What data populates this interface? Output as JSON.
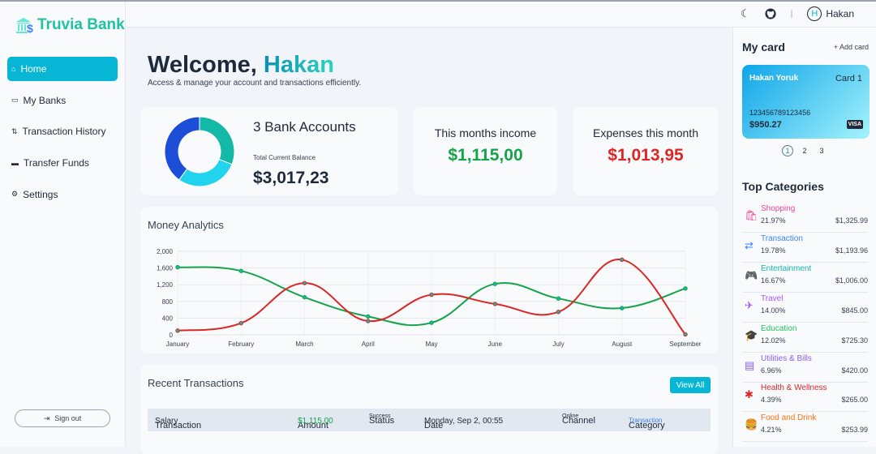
{
  "app": {
    "name": "Truvia Bank"
  },
  "sidebar": {
    "items": [
      {
        "label": "Home",
        "icon": "home-icon",
        "active": true
      },
      {
        "label": "My Banks",
        "icon": "wallet-icon"
      },
      {
        "label": "Transaction History",
        "icon": "transfer-icon"
      },
      {
        "label": "Transfer Funds",
        "icon": "credit-card-icon"
      },
      {
        "label": "Settings",
        "icon": "gear-icon"
      }
    ],
    "signout": "Sign out"
  },
  "header": {
    "user": "Hakan",
    "avatar_initial": "H",
    "separator": "|"
  },
  "welcome": {
    "greeting": "Welcome,",
    "name": "Hakan",
    "subtitle": "Access & manage your account and transactions efficiently."
  },
  "accounts": {
    "title": "3 Bank Accounts",
    "balance_label": "Total Current Balance",
    "balance": "$3,017,23",
    "donut_colors": [
      "#14b8a6",
      "#22d3ee",
      "#1d4ed8"
    ],
    "donut_shares": [
      0.31,
      0.29,
      0.4
    ]
  },
  "income": {
    "label": "This months income",
    "value": "$1,115,00",
    "color": "#16a34a"
  },
  "expenses": {
    "label": "Expenses this month",
    "value": "$1,013,95",
    "color": "#dc2626"
  },
  "chart_data": {
    "type": "line",
    "title": "Money Analytics",
    "categories": [
      "January",
      "February",
      "March",
      "April",
      "May",
      "June",
      "July",
      "August",
      "September"
    ],
    "ylim": [
      0,
      2000
    ],
    "yticks": [
      "0",
      "400",
      "800",
      "1,200",
      "1,600",
      "2,000"
    ],
    "grid": true,
    "series": [
      {
        "color": "#16a34a",
        "values": [
          1620,
          1530,
          900,
          440,
          290,
          1220,
          870,
          640,
          1110
        ]
      },
      {
        "color": "#dc2626",
        "values": [
          100,
          280,
          1240,
          330,
          960,
          740,
          550,
          1800,
          10
        ]
      }
    ]
  },
  "transactions": {
    "title": "Recent Transactions",
    "view_all": "View All",
    "columns": [
      "Transaction",
      "Amount",
      "Status",
      "Date",
      "Channel",
      "Category"
    ],
    "rows": [
      {
        "name": "Salary",
        "amount": "$1,115.00",
        "status": "Success",
        "date": "Monday, Sep 2, 00:55",
        "channel": "Online",
        "category": "Transaction"
      }
    ]
  },
  "mycard": {
    "title": "My card",
    "add": "+ Add card",
    "holder": "Hakan Yoruk",
    "label": "Card 1",
    "number": "123456789123456",
    "balance": "$950.27",
    "brand": "VISA",
    "pages": [
      "1",
      "2",
      "3"
    ]
  },
  "categories": {
    "title": "Top Categories",
    "items": [
      {
        "name": "Shopping",
        "pct": "21.97%",
        "amount": "$1,325.99",
        "color": "#ec4899",
        "icon": "shopping-bag-icon",
        "glyph": "🛍"
      },
      {
        "name": "Transaction",
        "pct": "19.78%",
        "amount": "$1,193.96",
        "color": "#3b82f6",
        "icon": "arrows-exchange-icon",
        "glyph": "⇄"
      },
      {
        "name": "Entertainment",
        "pct": "16.67%",
        "amount": "$1,006.00",
        "color": "#14b8a6",
        "icon": "gamepad-icon",
        "glyph": "🎮"
      },
      {
        "name": "Travel",
        "pct": "14.00%",
        "amount": "$845.00",
        "color": "#a855f7",
        "icon": "airplane-icon",
        "glyph": "✈"
      },
      {
        "name": "Education",
        "pct": "12.02%",
        "amount": "$725.30",
        "color": "#22c55e",
        "icon": "graduation-cap-icon",
        "glyph": "🎓"
      },
      {
        "name": "Utilities & Bills",
        "pct": "6.96%",
        "amount": "$420.00",
        "color": "#8b5cf6",
        "icon": "bill-icon",
        "glyph": "▤"
      },
      {
        "name": "Health & Wellness",
        "pct": "4.39%",
        "amount": "$265.00",
        "color": "#dc2626",
        "icon": "asterisk-icon",
        "glyph": "✱"
      },
      {
        "name": "Food and Drink",
        "pct": "4.21%",
        "amount": "$253.99",
        "color": "#f97316",
        "icon": "food-icon",
        "glyph": "🍔"
      }
    ]
  }
}
